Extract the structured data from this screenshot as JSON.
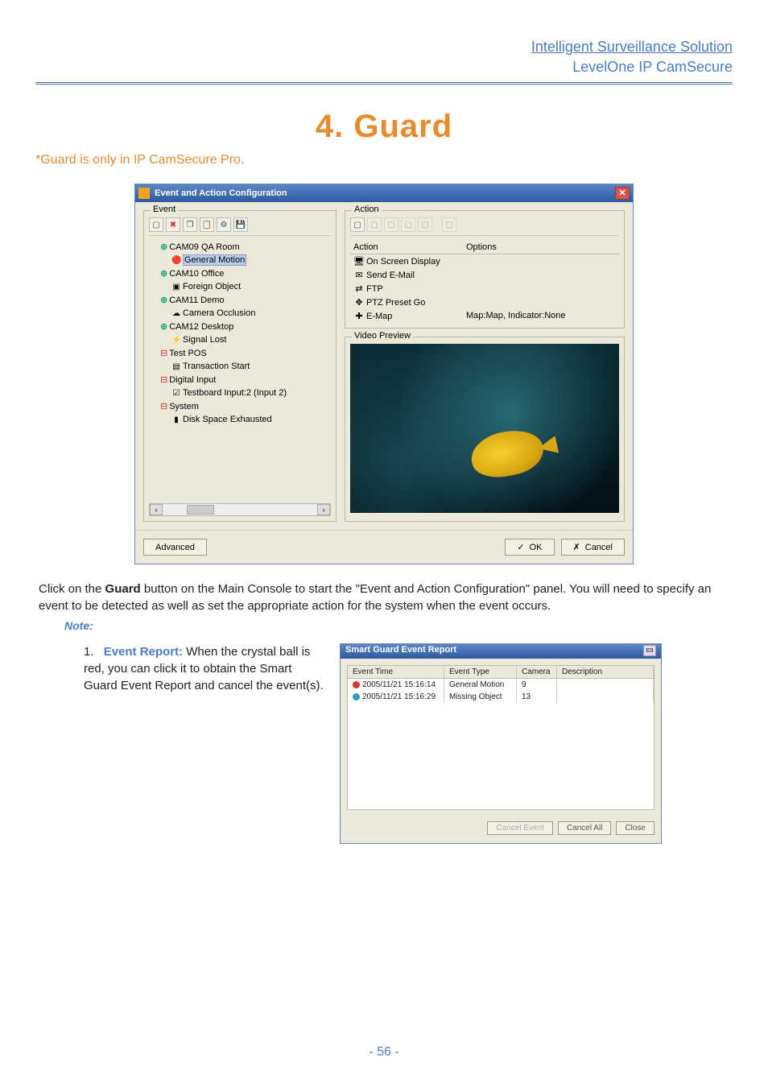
{
  "header": {
    "line1": "Intelligent Surveillance Solution",
    "line2": "LevelOne IP CamSecure"
  },
  "chapter": {
    "title": "4. Guard"
  },
  "orange_note": "*Guard is only in IP CamSecure Pro.",
  "dialog": {
    "title": "Event and Action Configuration",
    "event_legend": "Event",
    "action_legend": "Action",
    "preview_legend": "Video Preview",
    "tree": [
      {
        "label": "CAM09 QA Room",
        "type": "cam",
        "children": [
          {
            "label": "General Motion",
            "icon": "🔴",
            "selected": true
          }
        ]
      },
      {
        "label": "CAM10 Office",
        "type": "cam",
        "children": [
          {
            "label": "Foreign Object",
            "icon": "▣"
          }
        ]
      },
      {
        "label": "CAM11 Demo",
        "type": "cam",
        "children": [
          {
            "label": "Camera Occlusion",
            "icon": "☁"
          }
        ]
      },
      {
        "label": "CAM12 Desktop",
        "type": "cam",
        "children": [
          {
            "label": "Signal Lost",
            "icon": "⚡"
          }
        ]
      },
      {
        "label": "Test POS",
        "type": "pos",
        "children": [
          {
            "label": "Transaction Start",
            "icon": "▤"
          }
        ]
      },
      {
        "label": "Digital Input",
        "type": "io",
        "children": [
          {
            "label": "Testboard Input:2 (Input 2)",
            "icon": "☑"
          }
        ]
      },
      {
        "label": "System",
        "type": "io",
        "children": [
          {
            "label": "Disk Space Exhausted",
            "icon": "▮"
          }
        ]
      }
    ],
    "action_headers": {
      "col1": "Action",
      "col2": "Options"
    },
    "actions": [
      {
        "icon": "🖥",
        "label": "On Screen Display",
        "options": ""
      },
      {
        "icon": "✉",
        "label": "Send E-Mail",
        "options": ""
      },
      {
        "icon": "⇄",
        "label": "FTP",
        "options": ""
      },
      {
        "icon": "✥",
        "label": "PTZ Preset Go",
        "options": ""
      },
      {
        "icon": "✚",
        "label": "E-Map",
        "options": "Map:Map, Indicator:None"
      }
    ],
    "buttons": {
      "advanced": "Advanced",
      "ok": "OK",
      "cancel": "Cancel"
    }
  },
  "body_text": "Click on the Guard button on the Main Console to start the \"Event and Action Configuration\" panel. You will need to specify an event to be detected as well as set the appropriate action for the system when the event occurs.",
  "body_text_pre": "Click on the ",
  "body_text_bold": "Guard",
  "body_text_post": " button on the Main Console to start the \"Event and Action Configuration\" panel. You will need to specify an event to be detected as well as set the appropriate action for the system when the event occurs.",
  "note_label": "Note:",
  "list_item": {
    "num": "1.",
    "heading": "Event Report:",
    "rest": " When the crystal ball is red, you can click it to obtain the Smart Guard Event Report and cancel the event(s)."
  },
  "report": {
    "title": "Smart Guard Event Report",
    "headers": {
      "time": "Event Time",
      "type": "Event Type",
      "cam": "Camera",
      "desc": "Description"
    },
    "rows": [
      {
        "ball": "red",
        "time": "2005/11/21 15:16:14",
        "type": "General Motion",
        "cam": "9",
        "desc": ""
      },
      {
        "ball": "blue",
        "time": "2005/11/21 15:16:29",
        "type": "Missing Object",
        "cam": "13",
        "desc": ""
      }
    ],
    "buttons": {
      "cancel_event": "Cancel Event",
      "cancel_all": "Cancel All",
      "close": "Close"
    }
  },
  "page_number": "- 56 -"
}
